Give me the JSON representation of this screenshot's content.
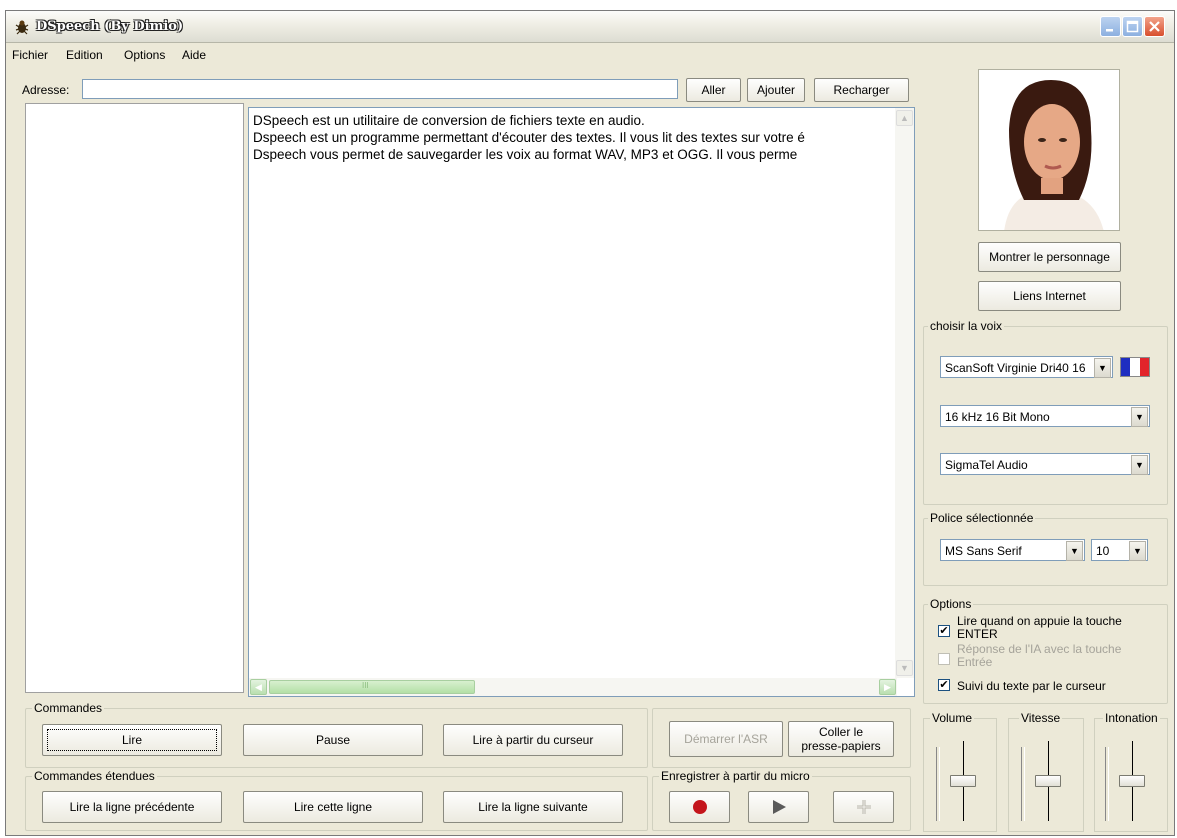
{
  "window": {
    "title": "DSpeech (By Dimio)"
  },
  "menu": [
    "Fichier",
    "Edition",
    "Options",
    "Aide"
  ],
  "address": {
    "label": "Adresse:",
    "value": "",
    "go": "Aller",
    "add": "Ajouter",
    "reload": "Recharger"
  },
  "text": {
    "lines": [
      "DSpeech est un utilitaire de conversion de fichiers texte en audio.",
      "Dspeech est un programme permettant d'écouter des textes. Il vous lit des textes sur votre é",
      "Dspeech vous permet de sauvegarder les voix au format WAV, MP3 et OGG. Il vous perme"
    ],
    "scroll_thumb_label": "III"
  },
  "character": {
    "show": "Montrer le personnage",
    "links": "Liens Internet"
  },
  "voice": {
    "title": "choisir la voix",
    "engine": "ScanSoft Virginie Dri40 16",
    "format": "16 kHz 16 Bit Mono",
    "device": "SigmaTel Audio"
  },
  "font": {
    "title": "Police sélectionnée",
    "family": "MS Sans Serif",
    "size": "10"
  },
  "options": {
    "title": "Options",
    "read_enter_1": "Lire quand on appuie la touche",
    "read_enter_2": "ENTER",
    "ia_1": "Réponse de l'IA avec la touche",
    "ia_2": "Entrée",
    "follow": "Suivi du texte par le curseur"
  },
  "commands": {
    "title": "Commandes",
    "read": "Lire",
    "pause": "Pause",
    "read_cursor": "Lire à partir du curseur"
  },
  "asr": {
    "start": "Démarrer l'ASR",
    "paste_1": "Coller le",
    "paste_2": "presse-papiers"
  },
  "extended": {
    "title": "Commandes étendues",
    "prev": "Lire la ligne précédente",
    "this": "Lire cette ligne",
    "next": "Lire la ligne suivante"
  },
  "record": {
    "title": "Enregistrer à partir du micro"
  },
  "sliders": {
    "volume": "Volume",
    "speed": "Vitesse",
    "pitch": "Intonation"
  },
  "colors": {
    "record": "#c4151c",
    "play": "#5a5a5a",
    "flag_blue": "#1f2ec0",
    "flag_red": "#e2242b"
  }
}
